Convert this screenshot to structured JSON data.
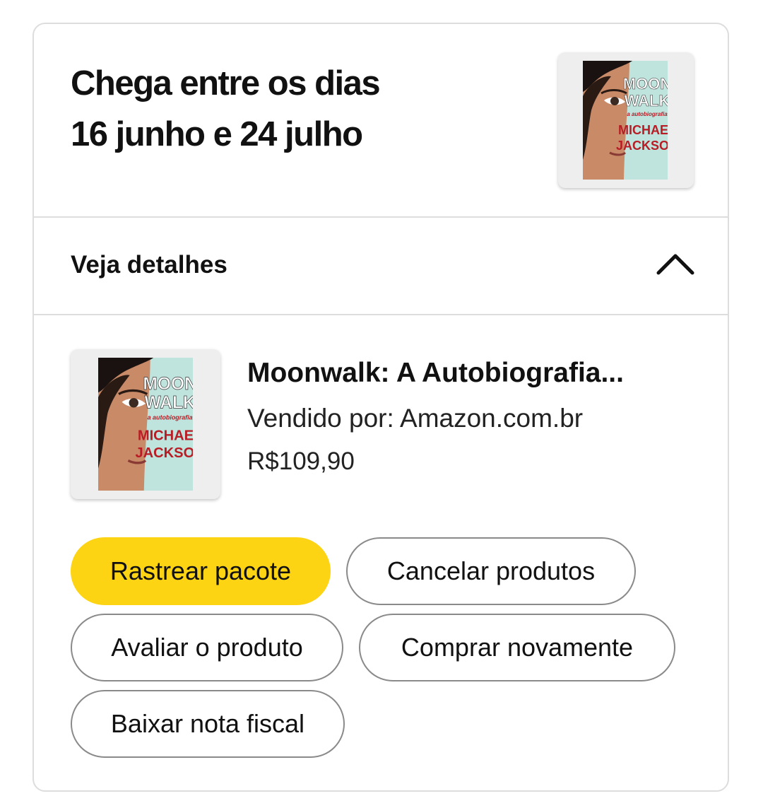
{
  "delivery": {
    "line1": "Chega entre os dias",
    "line2": "16 junho e 24 julho"
  },
  "details_toggle": {
    "label": "Veja detalhes",
    "icon": "chevron-up-icon",
    "expanded": true
  },
  "item": {
    "title": "Moonwalk: A Autobiografia...",
    "seller": "Vendido por: Amazon.com.br",
    "price": "R$109,90",
    "cover": {
      "line1": "MOON",
      "line2": "WALK",
      "subtitle": "a autobiografia",
      "author1": "MICHAEL",
      "author2": "JACKSON"
    }
  },
  "buttons": {
    "track": "Rastrear pacote",
    "cancel": "Cancelar produtos",
    "review": "Avaliar o produto",
    "buy_again": "Comprar novamente",
    "invoice": "Baixar nota fiscal"
  },
  "colors": {
    "primary_button": "#fcd414",
    "border": "#dddddd",
    "button_border": "#8a8a8a",
    "text": "#111111"
  }
}
